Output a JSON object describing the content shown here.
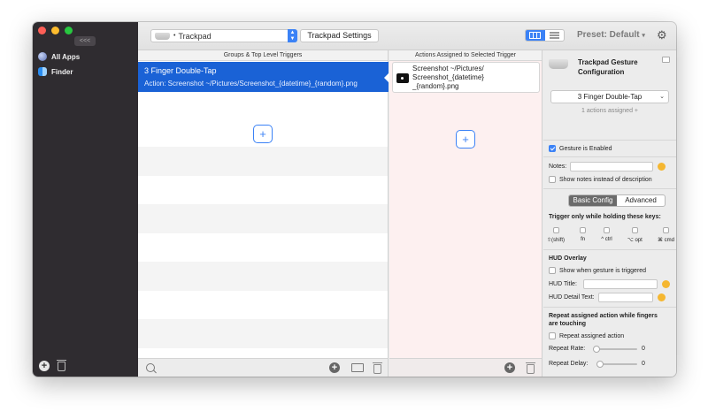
{
  "sidebar": {
    "collapse_label": "<<<",
    "apps": [
      {
        "label": "All Apps",
        "icon": "globe-icon"
      },
      {
        "label": "Finder",
        "icon": "finder-icon"
      }
    ]
  },
  "toolbar": {
    "device": "Trackpad",
    "trackpad_settings_label": "Trackpad Settings",
    "preset_label": "Preset: Default",
    "preset_chevron": "▾",
    "accent_color": "#3b82f6"
  },
  "triggers_column": {
    "header": "Groups & Top Level Triggers",
    "selected_trigger": {
      "title": "3 Finger Double-Tap",
      "action": "Action: Screenshot ~/Pictures/Screenshot_{datetime}_{random}.png"
    },
    "add_symbol": "+"
  },
  "actions_column": {
    "header": "Actions Assigned to Selected Trigger",
    "action_text": "Screenshot ~/Pictures/\nScreenshot_{datetime}\n_{random}.png",
    "add_symbol": "+"
  },
  "config": {
    "title": "Trackpad Gesture\nConfiguration",
    "gesture": "3 Finger Double-Tap",
    "assigned_count": "1 actions assigned +",
    "gesture_enabled_label": "Gesture is Enabled",
    "notes_label": "Notes:",
    "show_notes_label": "Show notes instead of description",
    "tabs": [
      "Basic Config",
      "Advanced"
    ],
    "trigger_keys_label": "Trigger only while holding these keys:",
    "modifier_keys": [
      "⇧(shift)",
      "fn",
      "^ ctrl",
      "⌥ opt",
      "⌘ cmd"
    ],
    "hud_heading": "HUD Overlay",
    "hud_show_label": "Show when gesture is triggered",
    "hud_title_label": "HUD Title:",
    "hud_detail_label": "HUD Detail Text:",
    "repeat_heading": "Repeat assigned action while fingers\nare touching",
    "repeat_label": "Repeat assigned action",
    "repeat_rate_label": "Repeat Rate:",
    "repeat_rate_value": "0",
    "repeat_delay_label": "Repeat Delay:",
    "repeat_delay_value": "0"
  }
}
